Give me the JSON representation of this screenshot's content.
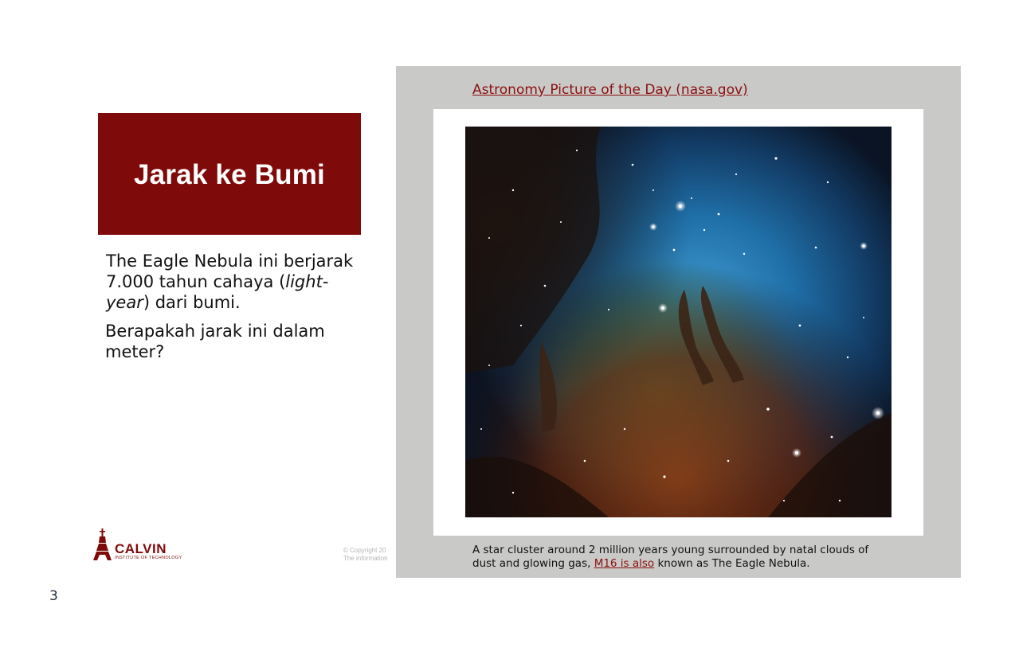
{
  "slide": {
    "title": "Jarak ke Bumi",
    "body": {
      "p1_a": "The Eagle Nebula ini berjarak 7.000 tahun cahaya (",
      "p1_em1": "light",
      "p1_dash": "-",
      "p1_em2": "year",
      "p1_b": ") dari bumi.",
      "p2": "Berapakah jarak ini dalam meter?"
    },
    "page_number": "3"
  },
  "logo": {
    "word": "CALVIN",
    "sub": "INSTITUTE OF TECHNOLOGY"
  },
  "footer": {
    "copyright_line1": "© Copyright 20",
    "copyright_line2": "The information"
  },
  "panel": {
    "link_text": "Astronomy Picture of the Day (nasa.gov)",
    "caption_a": "A star cluster around 2 million years young surrounded by natal clouds of dust and glowing gas, ",
    "caption_link": "M16 is also",
    "caption_b": " known as The Eagle Nebula."
  },
  "colors": {
    "brand": "#7e0a09",
    "link": "#8b0f0f",
    "panel_bg": "#c9cac8"
  }
}
